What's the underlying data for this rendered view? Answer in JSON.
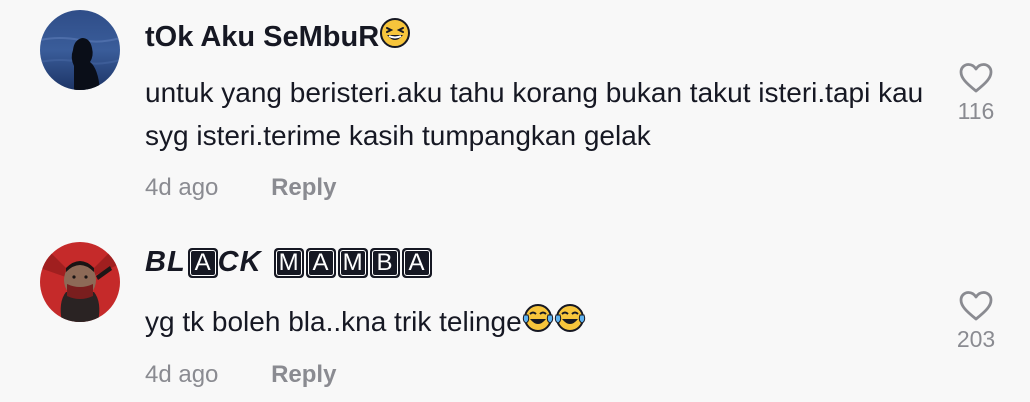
{
  "comments": [
    {
      "username": "tOk Aku SeMbuR",
      "username_emoji": "grinning-squinting-face",
      "text": "untuk yang beristeri.aku tahu korang bukan takut isteri.tapi kau syg isteri.terime kasih tumpangkan gelak",
      "time": "4d ago",
      "reply_label": "Reply",
      "like_count": "116"
    },
    {
      "username_parts": {
        "styled_1": "BL",
        "boxed_1": "A",
        "styled_2": "CK",
        "boxed_word": [
          "M",
          "A",
          "M",
          "B",
          "A"
        ]
      },
      "text": "yg tk boleh bla..kna trik telinge",
      "text_emojis": [
        "face-with-tears-of-joy",
        "face-with-tears-of-joy"
      ],
      "time": "4d ago",
      "reply_label": "Reply",
      "like_count": "203"
    }
  ],
  "colors": {
    "background": "#f8f8f8",
    "primary_text": "#161823",
    "secondary_text": "#8a8b91"
  }
}
